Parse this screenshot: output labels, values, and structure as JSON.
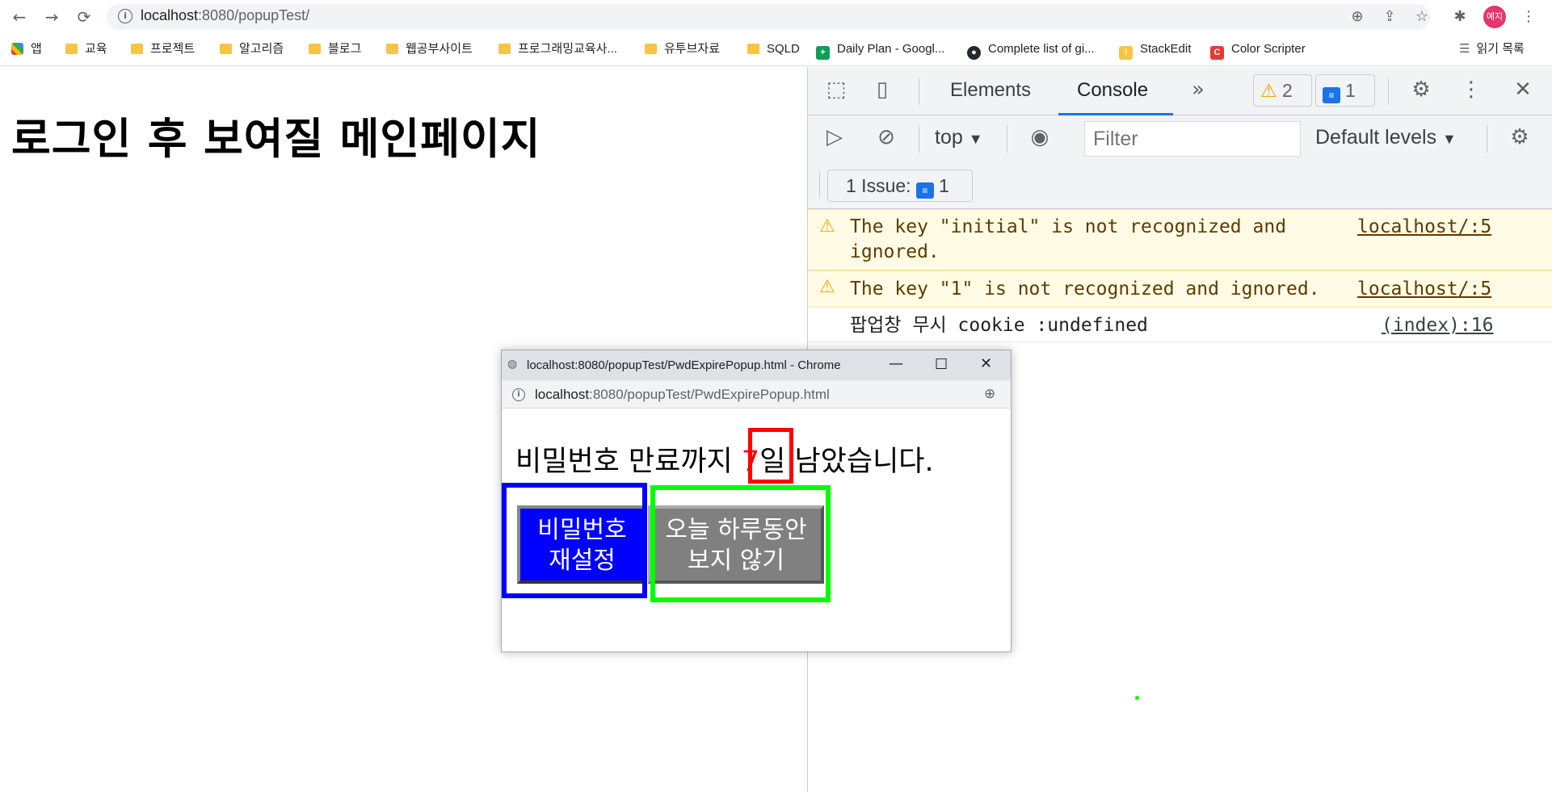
{
  "browser": {
    "url_host": "localhost",
    "url_rest": ":8080/popupTest/",
    "avatar_label": "예지",
    "nav_icons": [
      "back-icon",
      "forward-icon",
      "reload-icon"
    ]
  },
  "bookmarks": [
    {
      "label": "앱",
      "icon": "apps-grid-icon"
    },
    {
      "label": "교육",
      "icon": "folder-icon"
    },
    {
      "label": "프로젝트",
      "icon": "folder-icon"
    },
    {
      "label": "알고리즘",
      "icon": "folder-icon"
    },
    {
      "label": "블로그",
      "icon": "folder-icon"
    },
    {
      "label": "웹공부사이트",
      "icon": "folder-icon"
    },
    {
      "label": "프로그래밍교육사...",
      "icon": "folder-icon"
    },
    {
      "label": "유투브자료",
      "icon": "folder-icon"
    },
    {
      "label": "SQLD",
      "icon": "folder-icon"
    },
    {
      "label": "Daily Plan - Googl...",
      "icon": "google-sheets-icon"
    },
    {
      "label": "Complete list of gi...",
      "icon": "github-icon"
    },
    {
      "label": "StackEdit",
      "icon": "stackedit-icon"
    },
    {
      "label": "Color Scripter",
      "icon": "color-scripter-icon"
    }
  ],
  "reading_list": "읽기 목록",
  "page": {
    "title": "로그인 후 보여질 메인페이지"
  },
  "devtools": {
    "tabs": {
      "elements": "Elements",
      "console": "Console"
    },
    "warn_count": "2",
    "msg_count": "1",
    "context": "top",
    "filter_placeholder": "Filter",
    "levels": "Default levels",
    "issues_label": "1 Issue:",
    "issues_count": "1",
    "messages": [
      {
        "text1": "The key \"initial\" is not recognized and",
        "text2": "ignored.",
        "source": "localhost/:5"
      },
      {
        "text1": "The key \"1\" is not recognized and ignored.",
        "source": "localhost/:5"
      },
      {
        "text1": "팝업창 무시 cookie :undefined",
        "source": "(index):16"
      }
    ]
  },
  "popup": {
    "window_title": "localhost:8080/popupTest/PwdExpirePopup.html - Chrome",
    "url_host": "localhost",
    "url_rest": ":8080/popupTest/PwdExpirePopup.html",
    "msg_before": "비밀번호 만료까지 ",
    "days": "7",
    "msg_after": "일 남았습니다.",
    "btn_reset_line1": "비밀번호",
    "btn_reset_line2": "재설정",
    "btn_today_line1": "오늘 하루동안",
    "btn_today_line2": "보지 않기"
  },
  "colors": {
    "highlight_red": "#ff0000",
    "highlight_blue": "#0000ff",
    "highlight_green": "#00ff00"
  }
}
